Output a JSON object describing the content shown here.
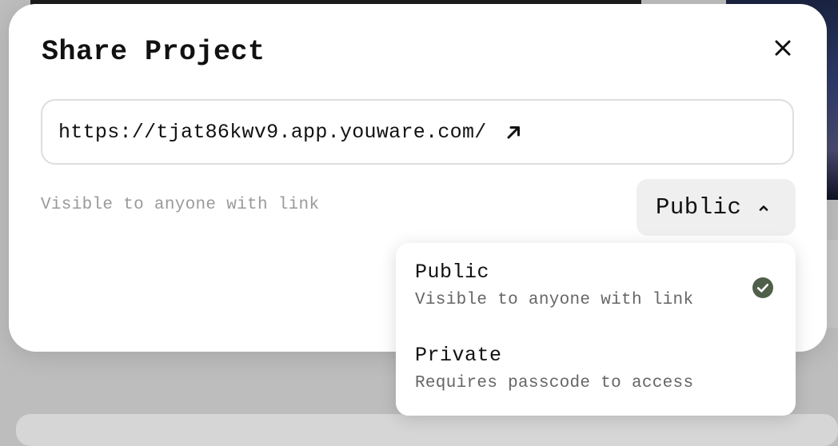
{
  "modal": {
    "title": "Share Project",
    "url": "https://tjat86kwv9.app.youware.com/",
    "visibility_description": "Visible to anyone with link",
    "visibility_selected": "Public"
  },
  "dropdown": {
    "options": [
      {
        "label": "Public",
        "description": "Visible to anyone with link",
        "selected": true
      },
      {
        "label": "Private",
        "description": "Requires passcode to access",
        "selected": false
      }
    ]
  },
  "colors": {
    "check": "#4f5f4a",
    "select_bg": "#efefef",
    "muted_text": "#9a9a9a"
  },
  "icons": [
    "close-icon",
    "external-link-arrow-icon",
    "chevron-up-icon",
    "check-circle-icon"
  ]
}
